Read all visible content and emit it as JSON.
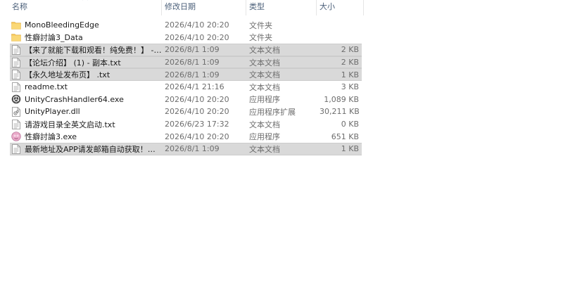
{
  "columns": {
    "name": "名称",
    "date": "修改日期",
    "type": "类型",
    "size": "大小"
  },
  "colors": {
    "folder": "#f7c75c",
    "selection": "#d9d9d9",
    "header_text": "#4c607a"
  },
  "files": [
    {
      "name": "MonoBleedingEdge",
      "date": "2026/4/10 20:20",
      "type": "文件夹",
      "size": "",
      "icon": "folder-icon",
      "selected": false
    },
    {
      "name": "性癖討論3_Data",
      "date": "2026/4/10 20:20",
      "type": "文件夹",
      "size": "",
      "icon": "folder-icon",
      "selected": false
    },
    {
      "name": "【来了就能下载和观看！纯免费！】 - 副...",
      "date": "2026/8/1 1:09",
      "type": "文本文档",
      "size": "2 KB",
      "icon": "text-file-icon",
      "selected": true
    },
    {
      "name": "【论坛介绍】 (1) - 副本.txt",
      "date": "2026/8/1 1:09",
      "type": "文本文档",
      "size": "2 KB",
      "icon": "text-file-icon",
      "selected": true
    },
    {
      "name": "【永久地址发布页】 .txt",
      "date": "2026/8/1 1:09",
      "type": "文本文档",
      "size": "1 KB",
      "icon": "text-file-icon",
      "selected": true
    },
    {
      "name": "readme.txt",
      "date": "2026/4/1 21:16",
      "type": "文本文档",
      "size": "3 KB",
      "icon": "text-file-icon",
      "selected": false
    },
    {
      "name": "UnityCrashHandler64.exe",
      "date": "2026/4/10 20:20",
      "type": "应用程序",
      "size": "1,089 KB",
      "icon": "unity-app-icon",
      "selected": false
    },
    {
      "name": "UnityPlayer.dll",
      "date": "2026/4/10 20:20",
      "type": "应用程序扩展",
      "size": "30,211 KB",
      "icon": "dll-file-icon",
      "selected": false
    },
    {
      "name": "请游戏目录全英文启动.txt",
      "date": "2026/6/23 17:32",
      "type": "文本文档",
      "size": "0 KB",
      "icon": "text-file-icon",
      "selected": false
    },
    {
      "name": "性癖討論3.exe",
      "date": "2026/4/10 20:20",
      "type": "应用程序",
      "size": "651 KB",
      "icon": "game-app-icon",
      "selected": false
    },
    {
      "name": "最新地址及APP请发邮箱自动获取！！！...",
      "date": "2026/8/1 1:09",
      "type": "文本文档",
      "size": "1 KB",
      "icon": "text-file-icon",
      "selected": true
    }
  ]
}
